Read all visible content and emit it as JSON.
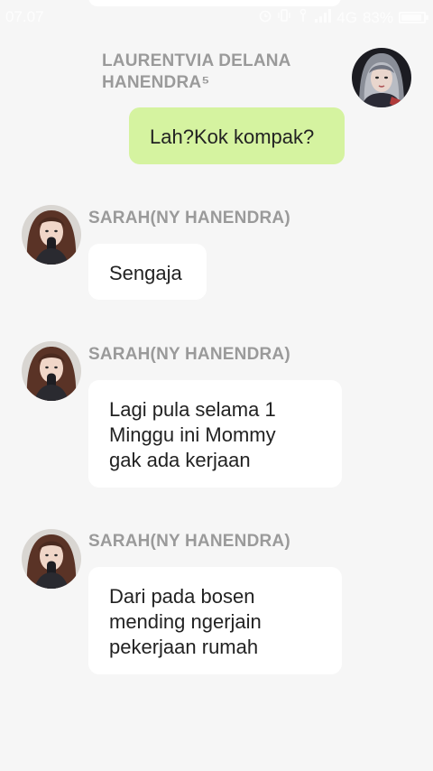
{
  "status_bar": {
    "time": "07.07",
    "network": "4G",
    "battery_text": "83%",
    "battery_level": 0.83
  },
  "messages": [
    {
      "sender": "LAURENTVIA DELANA HANENDRA⁵",
      "text": "Lah?Kok kompak?",
      "direction": "outgoing"
    },
    {
      "sender": "SARAH(NY HANENDRA)",
      "text": "Sengaja",
      "direction": "incoming"
    },
    {
      "sender": "SARAH(NY HANENDRA)",
      "lines": [
        "Lagi pula selama 1",
        "Minggu ini Mommy",
        "gak ada kerjaan"
      ],
      "direction": "incoming"
    },
    {
      "sender": "SARAH(NY HANENDRA)",
      "lines": [
        "Dari pada bosen",
        "mending ngerjain",
        "pekerjaan rumah"
      ],
      "direction": "incoming"
    }
  ],
  "colors": {
    "background": "#f6f6f6",
    "outgoing_bubble": "#d5f3a0",
    "incoming_bubble": "#ffffff",
    "sender_name": "#9a9a9a"
  }
}
